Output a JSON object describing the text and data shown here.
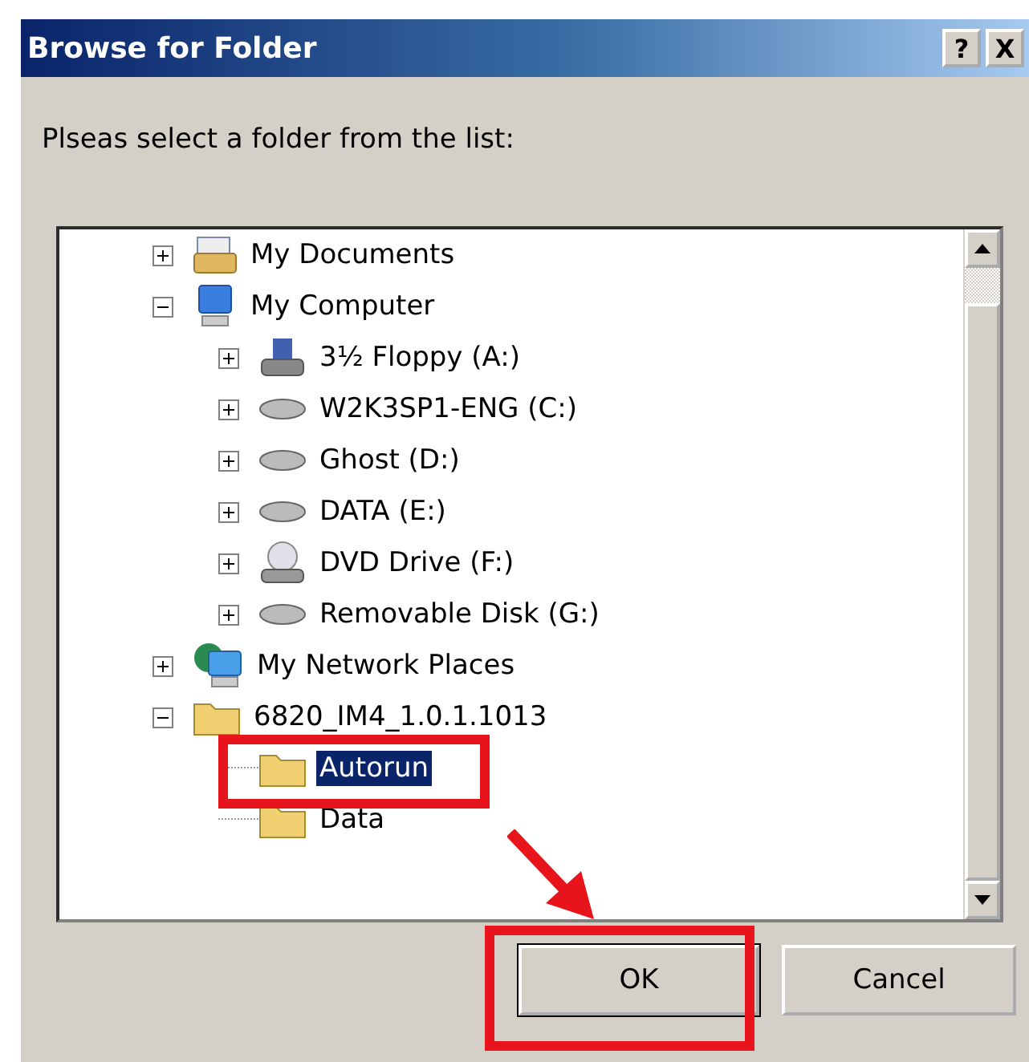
{
  "window": {
    "title": "Browse for Folder",
    "title_buttons": [
      "?",
      "X"
    ]
  },
  "prompt": "Plseas select a folder from the list:",
  "tree": [
    {
      "label": "My Documents",
      "kind": "documents",
      "expanded": false,
      "selected": false
    },
    {
      "label": "My Computer",
      "kind": "computer",
      "expanded": true,
      "selected": false,
      "children": [
        {
          "label": "3½ Floppy (A:)",
          "kind": "floppy",
          "expanded": false,
          "selected": false
        },
        {
          "label": "W2K3SP1-ENG (C:)",
          "kind": "drive",
          "expanded": false,
          "selected": false
        },
        {
          "label": "Ghost (D:)",
          "kind": "drive",
          "expanded": false,
          "selected": false
        },
        {
          "label": "DATA (E:)",
          "kind": "drive",
          "expanded": false,
          "selected": false
        },
        {
          "label": "DVD Drive (F:)",
          "kind": "dvd",
          "expanded": false,
          "selected": false
        },
        {
          "label": "Removable Disk (G:)",
          "kind": "drive",
          "expanded": false,
          "selected": false
        }
      ]
    },
    {
      "label": "My Network Places",
      "kind": "network",
      "expanded": false,
      "selected": false
    },
    {
      "label": "6820_IM4_1.0.1.1013",
      "kind": "folder",
      "expanded": true,
      "selected": false,
      "children": [
        {
          "label": "Autorun",
          "kind": "folder",
          "selected": true
        },
        {
          "label": "Data",
          "kind": "folder",
          "selected": false
        }
      ]
    }
  ],
  "buttons": [
    {
      "label": "OK",
      "default": true
    },
    {
      "label": "Cancel",
      "default": false
    }
  ]
}
